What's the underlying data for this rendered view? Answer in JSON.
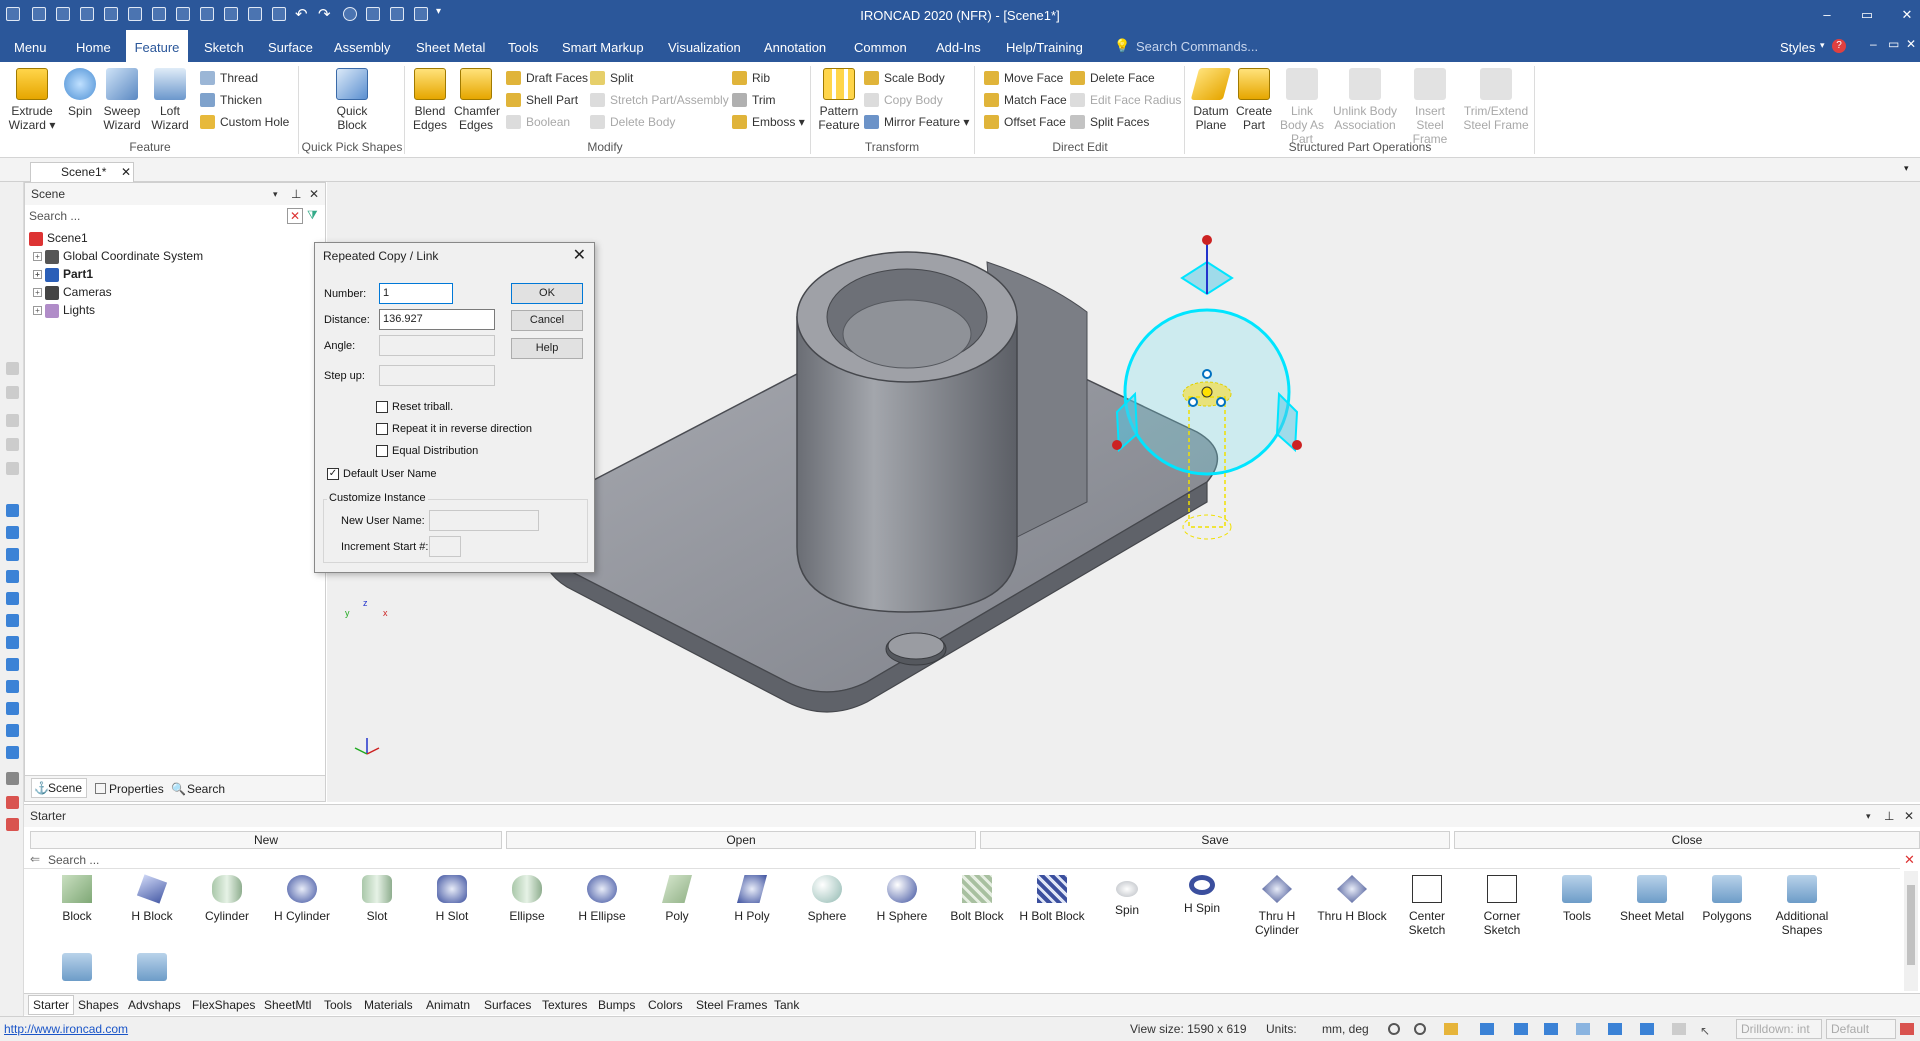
{
  "app": {
    "title": "IRONCAD 2020 (NFR) - [Scene1*]",
    "window_controls": {
      "minimize": "–",
      "restore": "▭",
      "close": "✕"
    }
  },
  "menu": {
    "tabs": [
      "Menu",
      "Home",
      "Feature",
      "Sketch",
      "Surface",
      "Assembly",
      "Sheet Metal",
      "Tools",
      "Smart Markup",
      "Visualization",
      "Annotation",
      "Common",
      "Add-Ins",
      "Help/Training"
    ],
    "active": "Feature",
    "search_placeholder": "Search Commands...",
    "styles_label": "Styles"
  },
  "ribbon": {
    "feature": {
      "label": "Feature",
      "extrude": "Extrude Wizard",
      "spin": "Spin",
      "sweep": "Sweep Wizard",
      "loft": "Loft Wizard",
      "thread": "Thread",
      "thicken": "Thicken",
      "custom_hole": "Custom Hole"
    },
    "quick_pick": {
      "label": "Quick Pick Shapes",
      "quick_block": "Quick Block"
    },
    "modify": {
      "label": "Modify",
      "blend_edges": "Blend Edges",
      "chamfer_edges": "Chamfer Edges",
      "draft_faces": "Draft Faces",
      "shell_part": "Shell Part",
      "boolean": "Boolean",
      "split": "Split",
      "stretch": "Stretch Part/Assembly",
      "delete_body": "Delete Body",
      "rib": "Rib",
      "trim": "Trim",
      "emboss": "Emboss"
    },
    "transform": {
      "label": "Transform",
      "pattern": "Pattern Feature",
      "scale_body": "Scale Body",
      "copy_body": "Copy Body",
      "mirror_feature": "Mirror Feature"
    },
    "direct_edit": {
      "label": "Direct Edit",
      "move_face": "Move Face",
      "match_face": "Match Face",
      "offset_face": "Offset Face",
      "delete_face": "Delete Face",
      "edit_face_radius": "Edit Face Radius",
      "split_faces": "Split Faces"
    },
    "structured": {
      "label": "Structured Part Operations",
      "datum_plane": "Datum Plane",
      "create_part": "Create Part",
      "link_body": "Link Body As Part",
      "unlink_body": "Unlink Body Association",
      "insert_steel": "Insert Steel Frame",
      "trim_steel": "Trim/Extend Steel Frame"
    }
  },
  "document": {
    "tab": "Scene1*"
  },
  "scene_panel": {
    "title": "Scene",
    "search_placeholder": "Search ...",
    "tree": [
      "Scene1",
      "Global Coordinate System",
      "Part1",
      "Cameras",
      "Lights"
    ],
    "tabs": [
      "Scene",
      "Properties",
      "Search"
    ]
  },
  "dialog": {
    "title": "Repeated Copy / Link",
    "number_label": "Number:",
    "number_value": "1",
    "distance_label": "Distance:",
    "distance_value": "136.927",
    "angle_label": "Angle:",
    "stepup_label": "Step up:",
    "ok": "OK",
    "cancel": "Cancel",
    "help": "Help",
    "reset_triball": "Reset triball.",
    "repeat_reverse": "Repeat it in reverse direction",
    "equal_distribution": "Equal Distribution",
    "default_user_name": "Default User Name",
    "customize_instance": "Customize Instance",
    "new_user_name": "New User Name:",
    "increment_start": "Increment Start #:",
    "checks": {
      "reset_triball": false,
      "repeat_reverse": false,
      "equal_distribution": false,
      "default_user_name": true
    }
  },
  "viewport": {
    "axis": {
      "x": "x",
      "y": "y",
      "z": "z"
    }
  },
  "starter": {
    "title": "Starter",
    "buttons": [
      "New",
      "Open",
      "Save",
      "Close"
    ],
    "search_placeholder": "Search ...",
    "items": [
      "Block",
      "H Block",
      "Cylinder",
      "H Cylinder",
      "Slot",
      "H Slot",
      "Ellipse",
      "H Ellipse",
      "Poly",
      "H Poly",
      "Sphere",
      "H Sphere",
      "Bolt Block",
      "H Bolt Block",
      "Spin",
      "H Spin",
      "Thru H Cylinder",
      "Thru H Block",
      "Center Sketch",
      "Corner Sketch",
      "Tools",
      "Sheet Metal",
      "Polygons",
      "Additional Shapes"
    ],
    "tabs": [
      "Starter",
      "Shapes",
      "Advshaps",
      "FlexShapes",
      "SheetMtl",
      "Tools",
      "Materials",
      "Animatn",
      "Surfaces",
      "Textures",
      "Bumps",
      "Colors",
      "Steel Frames",
      "Tank"
    ]
  },
  "status": {
    "url": "http://www.ironcad.com",
    "view_size": "View size: 1590 x 619",
    "units_label": "Units:",
    "units_value": "mm, deg",
    "drilldown": "Drilldown: int",
    "default": "Default"
  },
  "colors": {
    "brand": "#2b579a",
    "selection": "#00e5ff",
    "part": "#8a8c92"
  }
}
